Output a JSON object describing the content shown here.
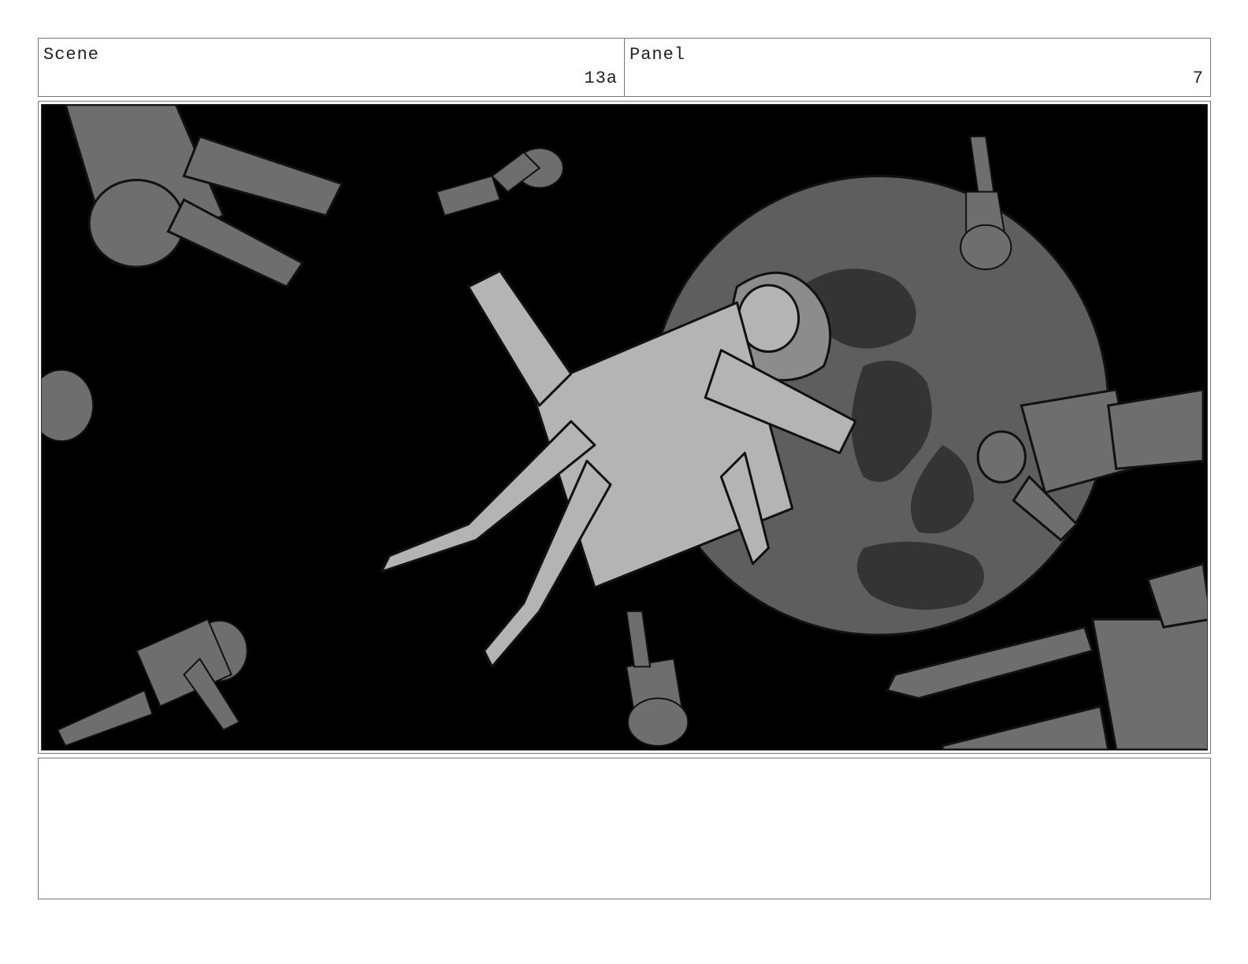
{
  "header": {
    "scene_label": "Scene",
    "scene_value": "13a",
    "panel_label": "Panel",
    "panel_value": "7"
  },
  "artwork": {
    "description_icon": "storyboard-drawing",
    "colors": {
      "background": "#000000",
      "planet_light": "#5e5e5e",
      "planet_dark": "#343434",
      "figure_main": "#b4b4b4",
      "figure_mid": "#8c8c8c",
      "figure_far": "#6e6e6e",
      "line": "#111111"
    }
  },
  "notes": {
    "text": ""
  }
}
